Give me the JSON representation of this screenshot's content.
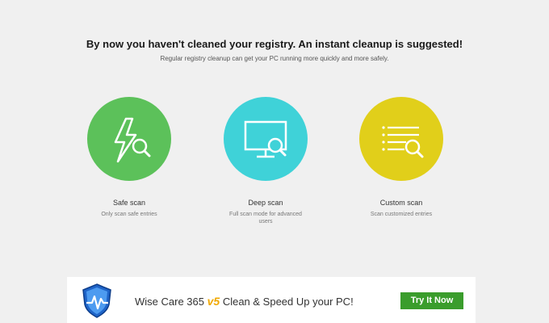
{
  "header": {
    "headline": "By now you haven't cleaned your registry. An instant cleanup is suggested!",
    "subline": "Regular registry cleanup can get your PC running more quickly and more safely."
  },
  "scans": [
    {
      "title": "Safe scan",
      "description": "Only scan safe entries",
      "color": "#5cc15a",
      "icon": "lightning-magnifier-icon"
    },
    {
      "title": "Deep scan",
      "description": "Full scan mode for advanced users",
      "color": "#3fd2d8",
      "icon": "monitor-magnifier-icon"
    },
    {
      "title": "Custom scan",
      "description": "Scan customized entries",
      "color": "#e1cf1a",
      "icon": "list-magnifier-icon"
    }
  ],
  "banner": {
    "product": "Wise Care 365",
    "version": "v5",
    "tagline": "Clean & Speed Up your PC!",
    "button_label": "Try It Now",
    "logo_icon": "shield-pulse-icon",
    "button_color": "#3a9d2c"
  }
}
